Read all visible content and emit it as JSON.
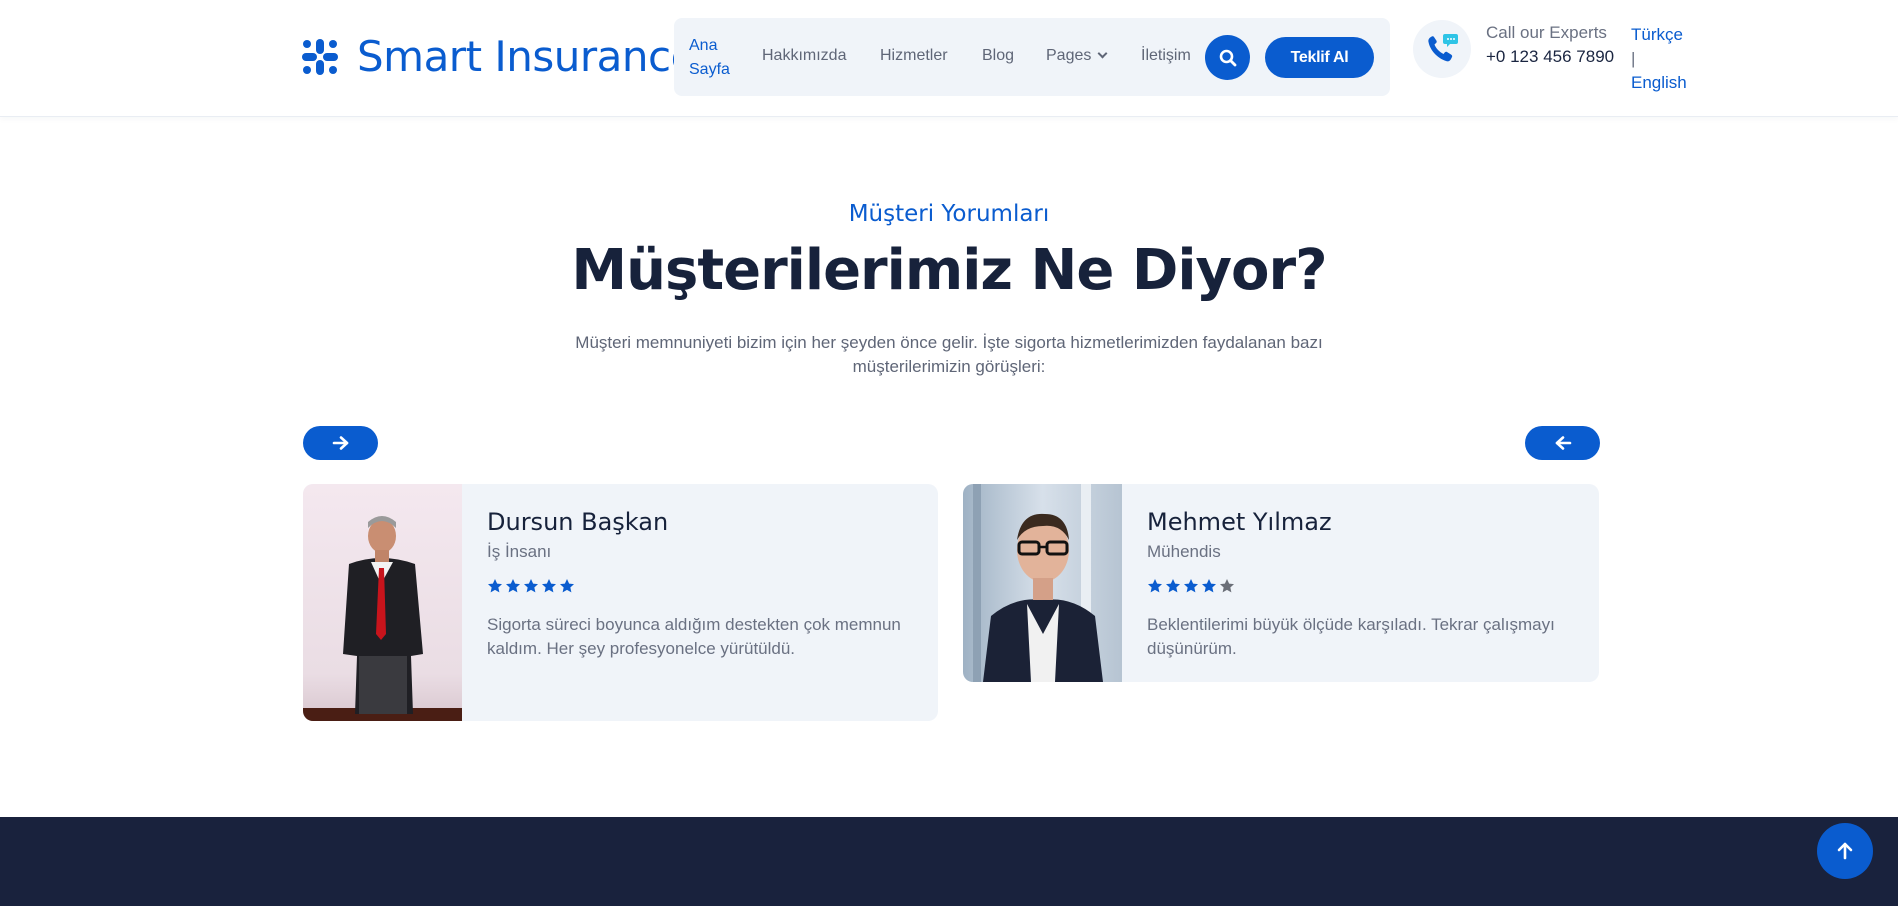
{
  "header": {
    "brand": "Smart Insurance",
    "nav": {
      "home_line1": "Ana",
      "home_line2": "Sayfa",
      "about": "Hakkımızda",
      "services": "Hizmetler",
      "blog": "Blog",
      "pages": "Pages",
      "contact": "İletişim"
    },
    "quote_button": "Teklif Al",
    "call_label": "Call our Experts",
    "call_number": "+0 123 456 7890",
    "lang_tr": "Türkçe",
    "lang_sep": "|",
    "lang_en": "English",
    "icons": [
      "slack-like-logo-icon",
      "search-icon",
      "chevron-down-icon",
      "phone-chat-icon"
    ]
  },
  "section": {
    "subtitle": "Müşteri Yorumları",
    "title": "Müşterilerimiz Ne Diyor?",
    "description": "Müşteri memnuniyeti bizim için her şeyden önce gelir. İşte sigorta hizmetlerimizden faydalanan bazı müşterilerimizin görüşleri:"
  },
  "testimonials": [
    {
      "name": "Dursun Başkan",
      "role": "İş İnsanı",
      "rating": 5,
      "rating_max": 5,
      "text": "Sigorta süreci boyunca aldığım destekten çok memnun kaldım. Her şey profesyonelce yürütüldü."
    },
    {
      "name": "Mehmet Yılmaz",
      "role": "Mühendis",
      "rating": 4,
      "rating_max": 5,
      "text": "Beklentilerimi büyük ölçüde karşıladı. Tekrar çalışmayı düşünürüm."
    }
  ],
  "colors": {
    "accent": "#0a5ccf",
    "heading": "#17223b",
    "card_bg": "#f0f4f9",
    "footer": "#19223d",
    "star_filled": "#0a5ccf",
    "star_empty": "#6b6f78"
  }
}
